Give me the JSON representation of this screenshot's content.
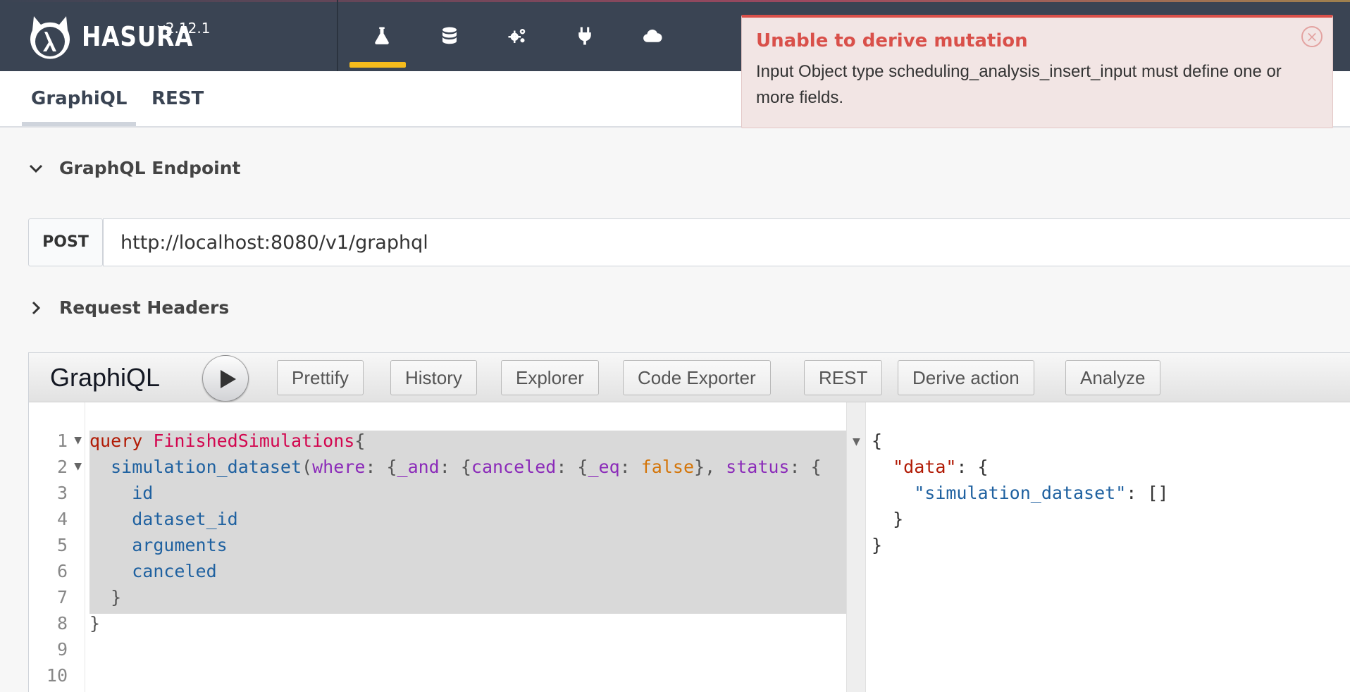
{
  "brand": {
    "name": "HASURA",
    "version": "v2.12.1"
  },
  "nav": {
    "items": [
      {
        "icon": "flask-icon",
        "active": true
      },
      {
        "icon": "database-icon",
        "active": false
      },
      {
        "icon": "gears-icon",
        "active": false
      },
      {
        "icon": "plug-icon",
        "active": false
      },
      {
        "icon": "cloud-icon",
        "active": false
      }
    ],
    "active_color": "#f6bc1c"
  },
  "toast": {
    "title": "Unable to derive mutation",
    "message": "Input Object type scheduling_analysis_insert_input must define one or more fields.",
    "close": "×",
    "accent": "#d9504a"
  },
  "tabs": {
    "graphiql": "GraphiQL",
    "rest": "REST"
  },
  "sections": {
    "endpoint": "GraphQL Endpoint",
    "headers": "Request Headers"
  },
  "endpoint": {
    "method": "POST",
    "url": "http://localhost:8080/v1/graphql"
  },
  "graphiql": {
    "title": "GraphiQL",
    "buttons": {
      "prettify": "Prettify",
      "history": "History",
      "explorer": "Explorer",
      "code_exporter": "Code Exporter",
      "rest": "REST",
      "derive_action": "Derive action",
      "analyze": "Analyze"
    },
    "line_numbers": [
      "1",
      "2",
      "3",
      "4",
      "5",
      "6",
      "7",
      "8",
      "9",
      "10"
    ],
    "code": {
      "l1_kw": "query",
      "l1_name": "FinishedSimulations",
      "l1_brace": "{",
      "l2_field": "simulation_dataset",
      "l2_p1": "(",
      "l2_where": "where",
      "l2_p2": ": {",
      "l2_and": "_and",
      "l2_p3": ": {",
      "l2_canceled": "canceled",
      "l2_p4": ": {",
      "l2_eq": "_eq",
      "l2_p5": ": ",
      "l2_false": "false",
      "l2_p6": "}, ",
      "l2_status": "status",
      "l2_p7": ": {",
      "l3": "id",
      "l4": "dataset_id",
      "l5": "arguments",
      "l6": "canceled",
      "l7": "}",
      "l8": "}"
    },
    "result": {
      "r1": "{",
      "r2_key": "\"data\"",
      "r2_rest": ": {",
      "r3_key": "\"simulation_dataset\"",
      "r3_rest": ": []",
      "r4": "}",
      "r5": "}"
    }
  }
}
